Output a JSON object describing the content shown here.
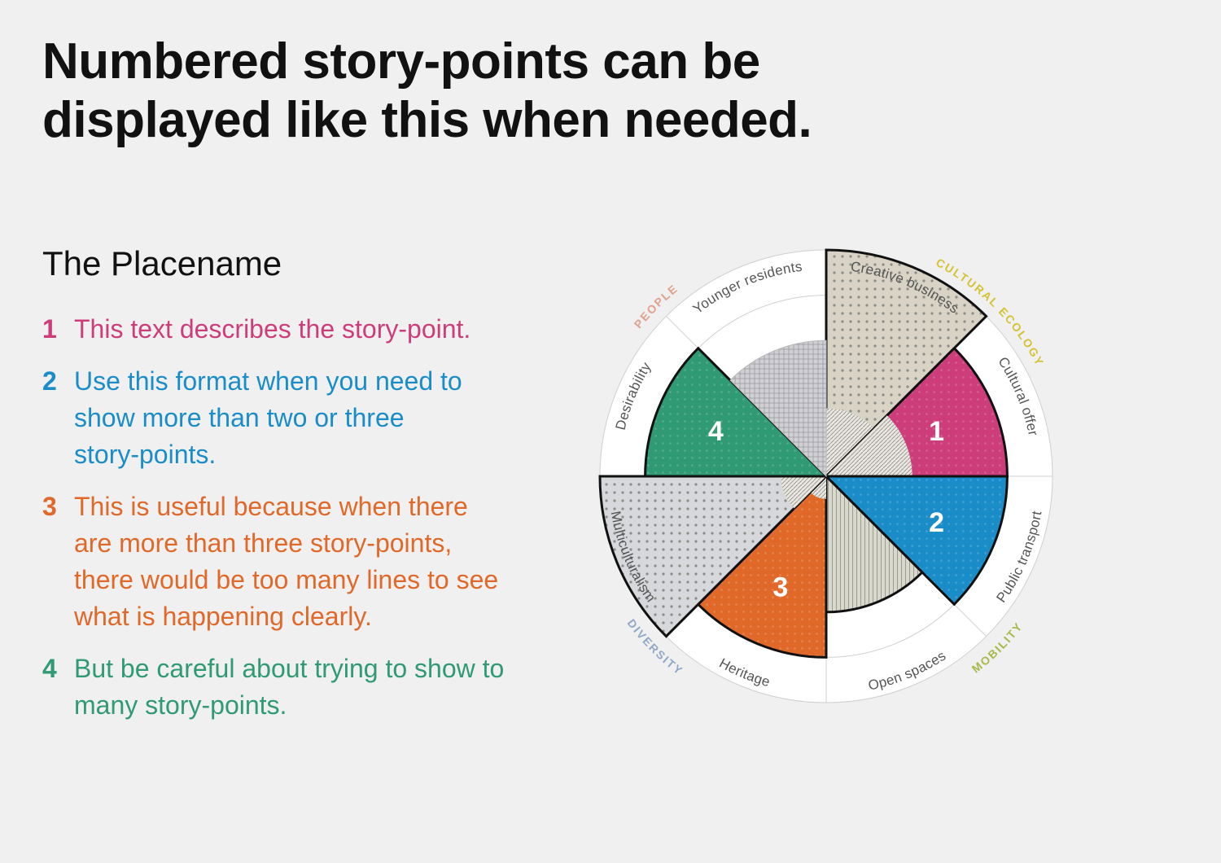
{
  "headline": "Numbered story-points can be displayed like this when needed.",
  "subtitle": "The Placename",
  "story_points": [
    {
      "number": "1",
      "text": "This text describes the story-point.",
      "color": "#cc3d7a"
    },
    {
      "number": "2",
      "text": "Use this format when you need to show more than two or three story-points.",
      "color": "#1a8dc8"
    },
    {
      "number": "3",
      "text": "This is useful because when there are more than three story-points, there would be too many lines to see what is happening clearly.",
      "color": "#e0692a"
    },
    {
      "number": "4",
      "text": "But be careful about trying to show to many story-points.",
      "color": "#2f9a74"
    }
  ],
  "chart_data": {
    "type": "polar-area",
    "max_value": 5,
    "start_angle_deg": 0,
    "segments": [
      {
        "label": "Creative business",
        "value": 5.0,
        "base": "#d8d3c4",
        "pattern": "dots",
        "outline": true
      },
      {
        "label": "Cultural offer",
        "value": 4.0,
        "story_point": "1",
        "color": "#cc3d7a"
      },
      {
        "label": "Public transport",
        "value": 4.0,
        "story_point": "2",
        "color": "#1a8dc8"
      },
      {
        "label": "Open spaces",
        "value": 3.0,
        "base": "#d8d8cc",
        "pattern": "vlines",
        "outline": true
      },
      {
        "label": "Heritage",
        "value": 4.0,
        "story_point": "3",
        "color": "#e0692a"
      },
      {
        "label": "Multiculturalism",
        "value": 5.0,
        "base": "#d6d8dc",
        "pattern": "dots",
        "outline": true
      },
      {
        "label": "Desirability",
        "value": 4.0,
        "story_point": "4",
        "color": "#2f9a74"
      },
      {
        "label": "Younger residents",
        "value": 3.0,
        "base": "#cfcfd4",
        "pattern": "crosshatch",
        "outline": false
      }
    ],
    "inner_values": [
      1.5,
      1.9,
      0.0,
      0.0,
      0.5,
      1.0,
      0.0,
      0.0
    ],
    "categories": [
      {
        "label": "CULTURAL ECOLOGY",
        "color": "#d4c234"
      },
      {
        "label": "MOBILITY",
        "color": "#a9b84a"
      },
      {
        "label": "DIVERSITY",
        "color": "#8fa8c8"
      },
      {
        "label": "PEOPLE",
        "color": "#e0a08c"
      }
    ]
  }
}
